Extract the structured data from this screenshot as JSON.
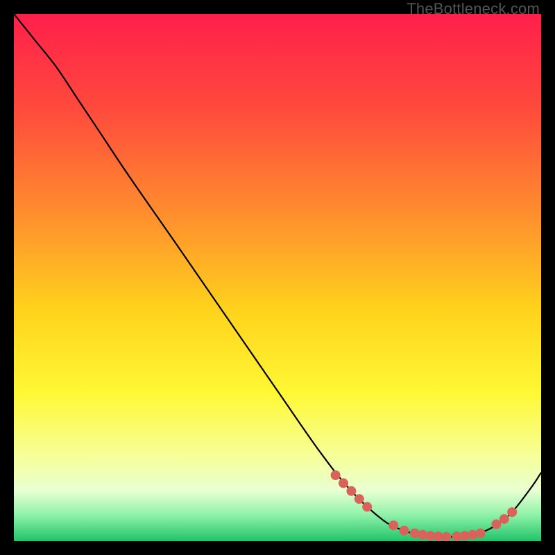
{
  "watermark": "TheBottleneck.com",
  "chart_data": {
    "type": "line",
    "title": "",
    "xlabel": "",
    "ylabel": "",
    "xlim": [
      0,
      100
    ],
    "ylim": [
      0,
      100
    ],
    "grid": false,
    "legend": false,
    "background_gradient": {
      "stops": [
        {
          "offset": 0.0,
          "color": "#ff1f4b"
        },
        {
          "offset": 0.18,
          "color": "#ff4a3c"
        },
        {
          "offset": 0.38,
          "color": "#ff8e2e"
        },
        {
          "offset": 0.56,
          "color": "#ffd21c"
        },
        {
          "offset": 0.72,
          "color": "#fff835"
        },
        {
          "offset": 0.84,
          "color": "#f6ff9a"
        },
        {
          "offset": 0.905,
          "color": "#e8ffd2"
        },
        {
          "offset": 0.95,
          "color": "#8ff2a8"
        },
        {
          "offset": 1.0,
          "color": "#20c36a"
        }
      ]
    },
    "series": [
      {
        "name": "bottleneck-curve",
        "x": [
          0,
          4,
          8,
          12,
          16,
          22,
          30,
          40,
          50,
          58,
          64,
          70,
          74,
          78,
          82,
          86,
          90,
          94,
          98,
          100
        ],
        "y": [
          100,
          95,
          90,
          84,
          78,
          69,
          57.5,
          43,
          28.5,
          17,
          9.5,
          4,
          2,
          1,
          0.8,
          1,
          2.2,
          5,
          10,
          13
        ]
      }
    ],
    "markers": {
      "name": "salient-points",
      "x": [
        61,
        62.5,
        64,
        65.5,
        67,
        72,
        74,
        76,
        77.5,
        79,
        80.5,
        82,
        84,
        85.5,
        87,
        88.5,
        91.5,
        93,
        94.5
      ],
      "y": [
        12.5,
        11,
        9.5,
        8,
        6.5,
        3,
        2,
        1.5,
        1.2,
        1,
        0.9,
        0.8,
        0.9,
        1,
        1.2,
        1.5,
        3.2,
        4.2,
        5.5
      ]
    }
  }
}
